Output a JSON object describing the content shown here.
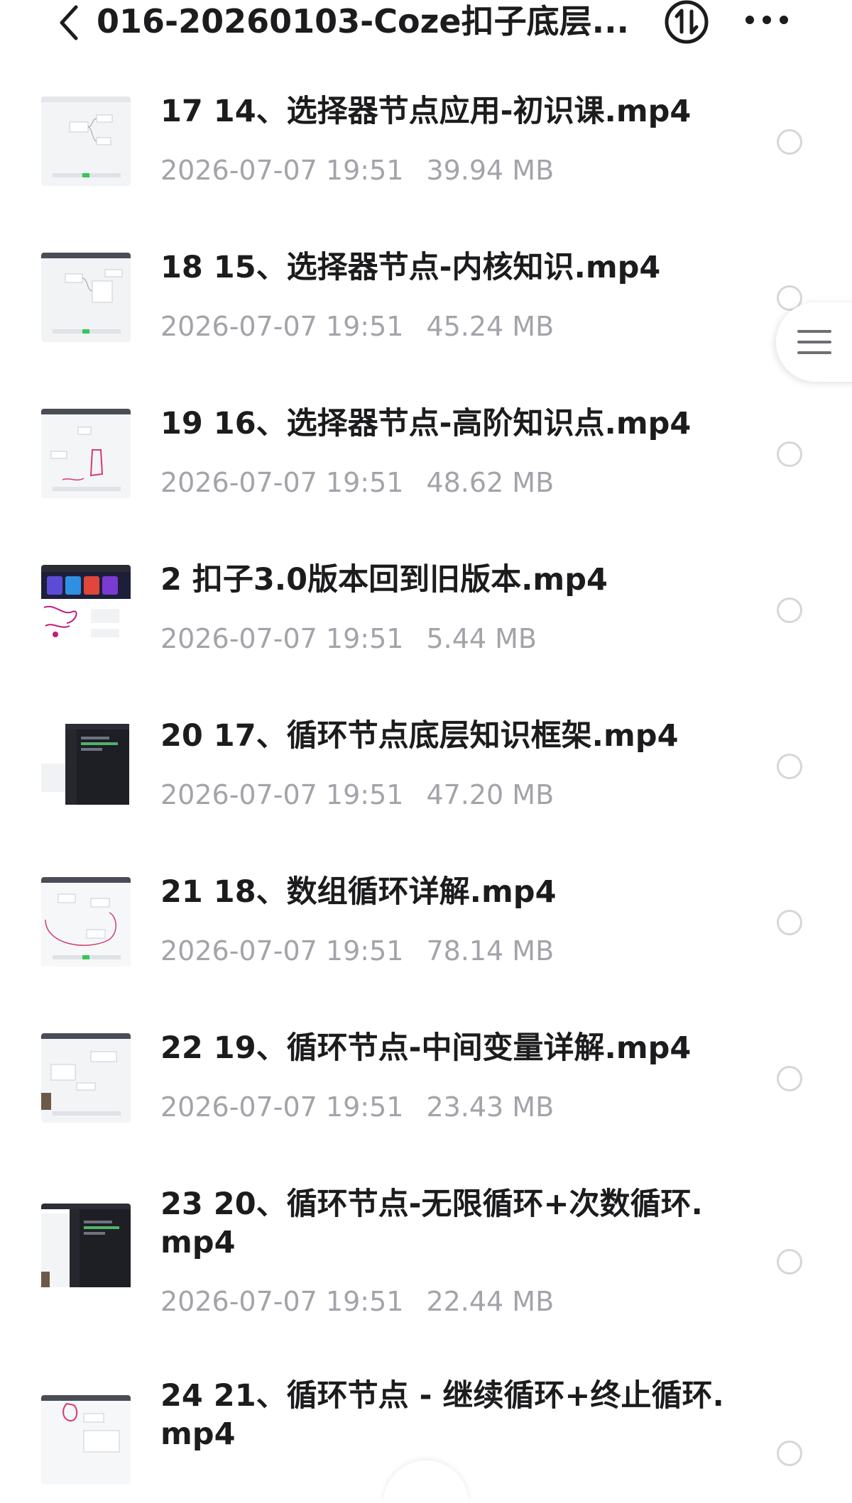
{
  "header": {
    "title": "016-20260103-Coze扣子底层...",
    "back_icon": "chevron-left-icon",
    "sort_icon": "sort-arrows-icon",
    "more_icon": "more-horizontal-icon"
  },
  "files": [
    {
      "name": "17 14、选择器节点应用-初识课.mp4",
      "date": "2026-07-07 19:51",
      "size": "39.94 MB",
      "thumbnail": "light-workflow-screenshot"
    },
    {
      "name": "18 15、选择器节点-内核知识.mp4",
      "date": "2026-07-07 19:51",
      "size": "45.24 MB",
      "thumbnail": "light-workflow-screenshot"
    },
    {
      "name": "19 16、选择器节点-高阶知识点.mp4",
      "date": "2026-07-07 19:51",
      "size": "48.62 MB",
      "thumbnail": "light-workflow-screenshot-annotated"
    },
    {
      "name": "2 扣子3.0版本回到旧版本.mp4",
      "date": "2026-07-07 19:51",
      "size": "5.44 MB",
      "thumbnail": "colorful-web-screenshot"
    },
    {
      "name": "20 17、循环节点底层知识框架.mp4",
      "date": "2026-07-07 19:51",
      "size": "47.20 MB",
      "thumbnail": "dark-ide-screenshot"
    },
    {
      "name": "21 18、数组循环详解.mp4",
      "date": "2026-07-07 19:51",
      "size": "78.14 MB",
      "thumbnail": "light-workflow-screenshot-annotated"
    },
    {
      "name": "22 19、循环节点-中间变量详解.mp4",
      "date": "2026-07-07 19:51",
      "size": "23.43 MB",
      "thumbnail": "light-workflow-screenshot"
    },
    {
      "name": "23 20、循环节点-无限循环+次数循环.mp4",
      "date": "2026-07-07 19:51",
      "size": "22.44 MB",
      "thumbnail": "dark-ide-screenshot"
    },
    {
      "name": "24 21、循环节点 - 继续循环+终止循环.mp4",
      "date": "",
      "size": "",
      "thumbnail": "light-workflow-screenshot-annotated"
    }
  ],
  "side_handle": {
    "icon": "menu-lines-icon"
  },
  "colors": {
    "text_primary": "#1c1c1e",
    "text_secondary": "#a3a3aa",
    "radio_border": "#d6d6da",
    "background": "#ffffff"
  }
}
